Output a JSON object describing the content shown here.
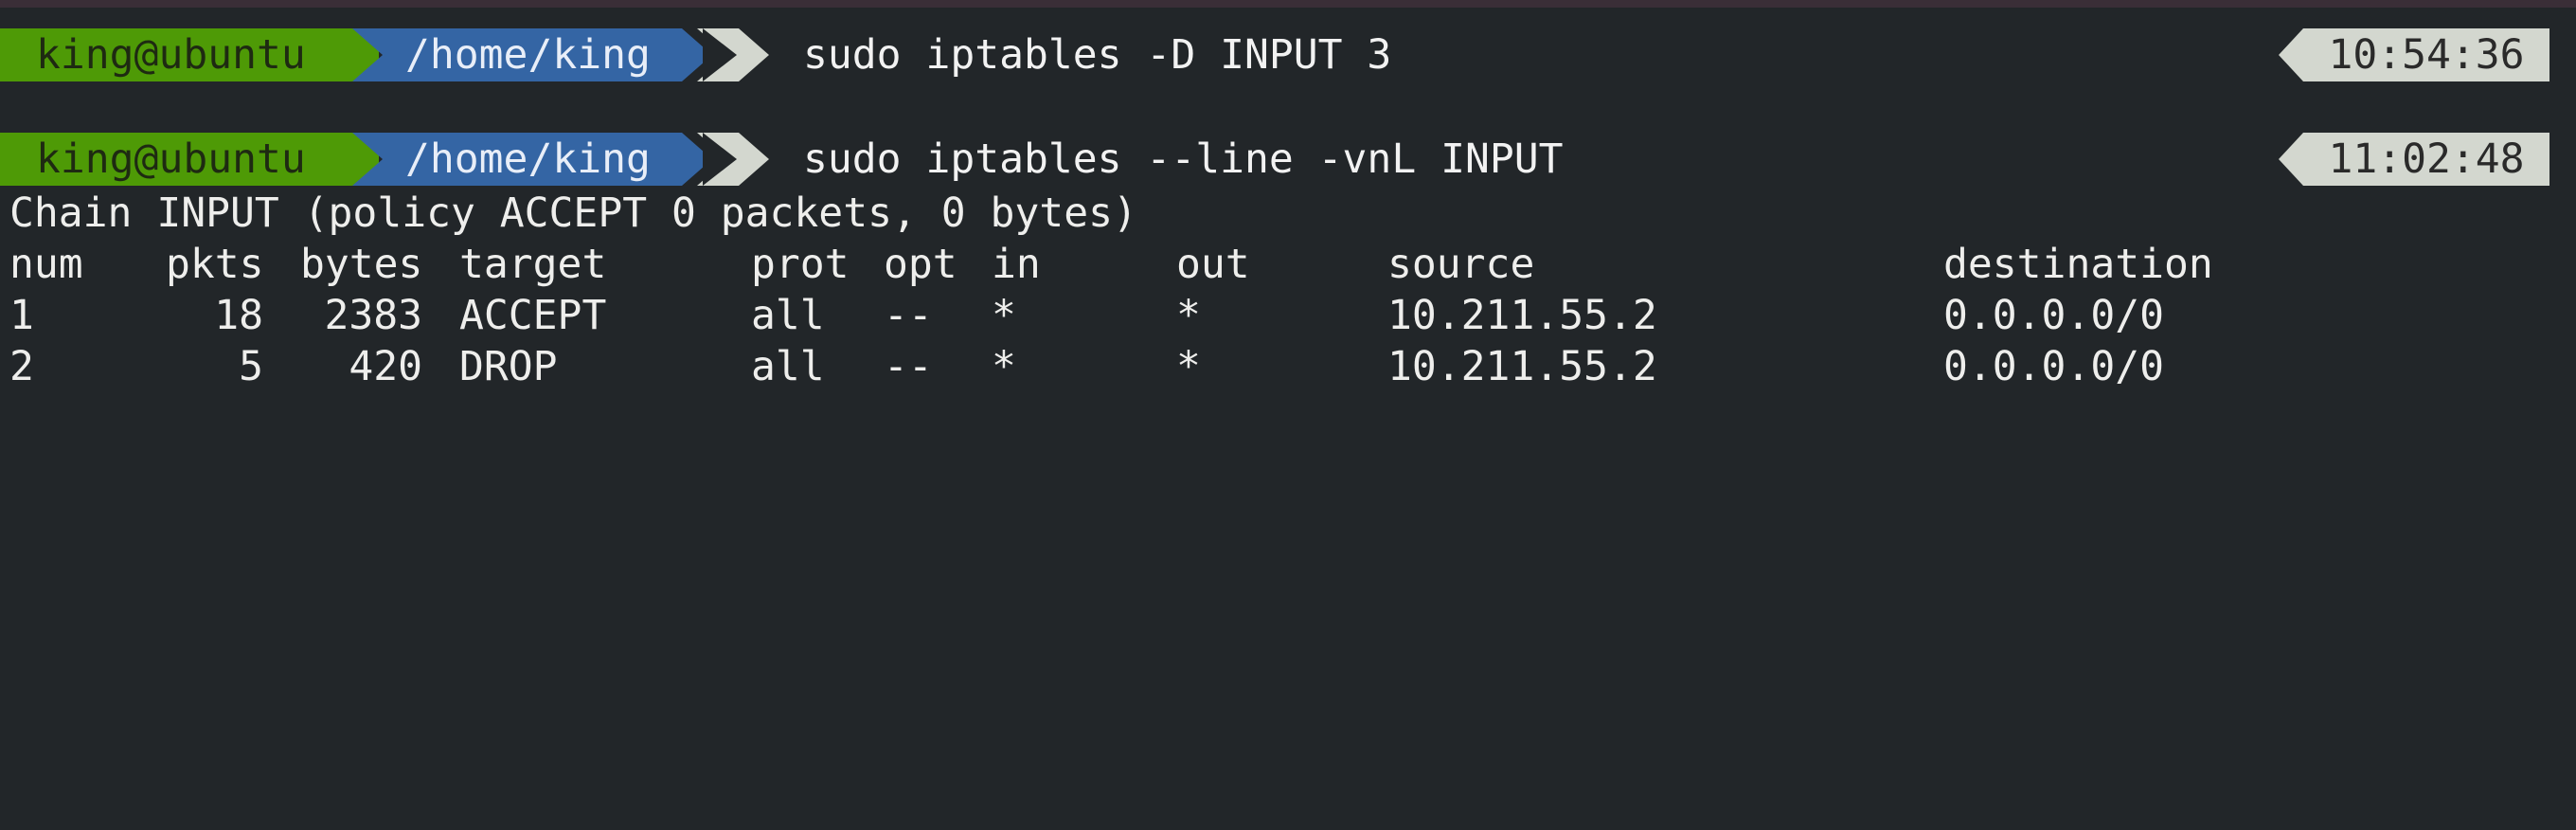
{
  "prompts": [
    {
      "user_host": "king@ubuntu",
      "path": "/home/king",
      "command": "sudo iptables -D INPUT 3",
      "time": "10:54:36"
    },
    {
      "user_host": "king@ubuntu",
      "path": "/home/king",
      "command": "sudo iptables --line -vnL INPUT",
      "time": "11:02:48"
    }
  ],
  "output": {
    "chain_line": "Chain INPUT (policy ACCEPT 0 packets, 0 bytes)",
    "headers": [
      "num",
      "pkts",
      "bytes",
      "target",
      "prot",
      "opt",
      "in",
      "out",
      "source",
      "destination"
    ],
    "rows": [
      [
        "1",
        "18",
        "2383",
        "ACCEPT",
        "all",
        "--",
        "*",
        "*",
        "10.211.55.2",
        "0.0.0.0/0"
      ],
      [
        "2",
        "5",
        "420",
        "DROP",
        "all",
        "--",
        "*",
        "*",
        "10.211.55.2",
        "0.0.0.0/0"
      ]
    ]
  },
  "colors": {
    "background": "#222629",
    "user_segment": "#4e9a06",
    "path_segment": "#3465a4",
    "tip_segment": "#d3d7cf",
    "clock_background": "#d3d7cf",
    "text": "#eeeeec"
  }
}
